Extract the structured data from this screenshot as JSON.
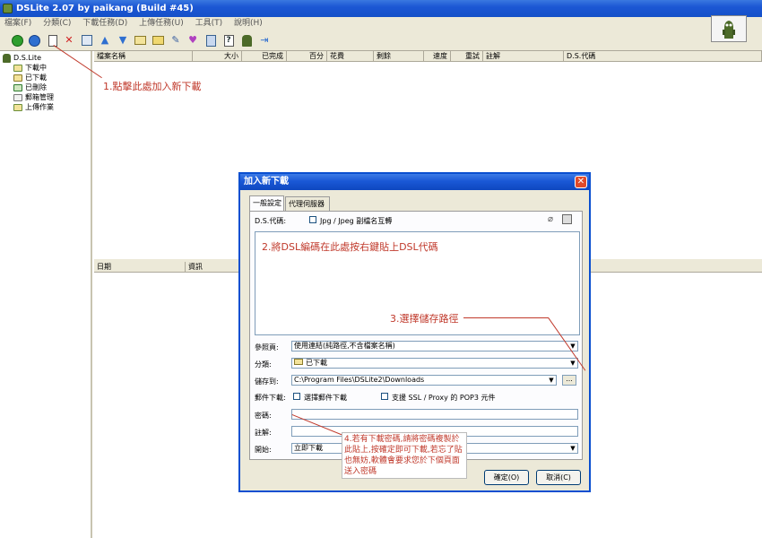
{
  "window": {
    "title": "DSLite 2.07 by paikang (Build #45)"
  },
  "menu": [
    "檔案(F)",
    "分類(C)",
    "下載任務(D)",
    "上傳任務(U)",
    "工具(T)",
    "說明(H)"
  ],
  "toolbar": {
    "icons": [
      "start-icon",
      "stop-icon",
      "new-download-icon",
      "delete-icon",
      "properties-icon",
      "move-up-icon",
      "move-down-icon",
      "open-folder-icon",
      "folder-icon",
      "edit-icon",
      "link-icon",
      "clipboard-icon",
      "help-icon",
      "game-icon",
      "exit-icon"
    ]
  },
  "tree": {
    "root": "D.S.Lite",
    "items": [
      "下載中",
      "已下載",
      "已刪除",
      "郵箱管理",
      "上傳作業"
    ]
  },
  "list": {
    "columns": [
      "檔案名稱",
      "大小",
      "已完成",
      "百分",
      "花費",
      "剩餘",
      "速度",
      "重試",
      "註解",
      "D.S.代碼"
    ]
  },
  "log": {
    "columns": [
      "日期",
      "資訊"
    ]
  },
  "annotations": {
    "step1": "1.點擊此處加入新下載",
    "step2": "2.將DSL編碼在此處按右鍵貼上DSL代碼",
    "step3": "3.選擇儲存路徑",
    "step4": "4.若有下載密碼,請將密碼複製於此貼上,按確定即可下載,若忘了貼也無妨,軟體會要求您於下個頁面送入密碼"
  },
  "dialog": {
    "title": "加入新下載",
    "tabs": [
      "一般設定",
      "代理伺服器"
    ],
    "ds_code_label": "D.S.代碼:",
    "jpg_option": "Jpg / Jpeg 副檔名互轉",
    "referer_label": "參照頁:",
    "referer_value": "使用連結(純路徑,不含檔案名稱)",
    "category_label": "分類:",
    "category_value": "已下載",
    "save_to_label": "儲存到:",
    "save_to_value": "C:\\Program Files\\DSLite2\\Downloads",
    "mail_download_label": "郵件下載:",
    "mail_download_option": "選擇郵件下載",
    "ssl_option": "支援 SSL / Proxy 的 POP3 元件",
    "password_label": "密碼:",
    "comment_label": "註解:",
    "start_label": "開始:",
    "start_value": "立即下載",
    "ok_button": "確定(O)",
    "cancel_button": "取消(C)",
    "browse_button": "..."
  },
  "colors": {
    "title_bar": "#1c57d4",
    "annotation": "#c0392b",
    "chrome": "#ece9d8"
  }
}
